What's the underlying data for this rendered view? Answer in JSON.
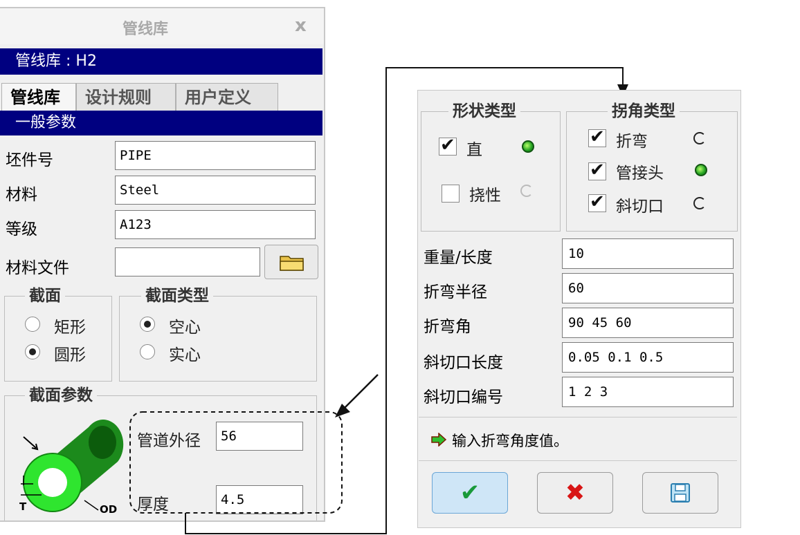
{
  "left_panel": {
    "title": "管线库",
    "close": "x",
    "library_label": "管线库 : H2",
    "tabs": [
      "管线库",
      "设计规则",
      "用户定义"
    ],
    "section_general": "一般参数",
    "fields": [
      {
        "label": "坯件号",
        "value": "PIPE"
      },
      {
        "label": "材料",
        "value": "Steel"
      },
      {
        "label": "等级",
        "value": "A123"
      },
      {
        "label": "材料文件",
        "value": ""
      }
    ],
    "section_shape": {
      "title": "截面",
      "options": [
        {
          "label": "矩形",
          "selected": false
        },
        {
          "label": "圆形",
          "selected": true
        }
      ]
    },
    "section_type": {
      "title": "截面类型",
      "options": [
        {
          "label": "空心",
          "selected": true
        },
        {
          "label": "实心",
          "selected": false
        }
      ]
    },
    "section_params": {
      "title": "截面参数",
      "outer_diameter": {
        "label": "管道外径",
        "value": "56"
      },
      "thickness": {
        "label": "厚度",
        "value": "4.5"
      },
      "diagram_labels": {
        "od": "OD",
        "t": "T"
      }
    },
    "icons": {
      "close": "close-icon",
      "folder": "folder-icon",
      "pipe": "pipe-cross-section-icon"
    }
  },
  "right_panel": {
    "shape_type": {
      "title": "形状类型",
      "options": [
        {
          "label": "直",
          "checked": true,
          "active": true
        },
        {
          "label": "挠性",
          "checked": false,
          "active": false
        }
      ]
    },
    "corner_type": {
      "title": "拐角类型",
      "options": [
        {
          "label": "折弯",
          "checked": true,
          "active": false
        },
        {
          "label": "管接头",
          "checked": true,
          "active": true
        },
        {
          "label": "斜切口",
          "checked": true,
          "active": false
        }
      ]
    },
    "fields": [
      {
        "label": "重量/长度",
        "value": "10"
      },
      {
        "label": "折弯半径",
        "value": "60"
      },
      {
        "label": "折弯角",
        "value": "90 45 60"
      },
      {
        "label": "斜切口长度",
        "value": "0.05 0.1 0.5"
      },
      {
        "label": "斜切口编号",
        "value": "1 2 3"
      }
    ],
    "prompt": "输入折弯角度值。",
    "buttons": {
      "ok": "✔",
      "cancel": "✖"
    },
    "colors": {
      "ok": "#1a9a3a",
      "cancel": "#d81515",
      "active_light": "#21a121",
      "header_bg": "#000080"
    }
  }
}
